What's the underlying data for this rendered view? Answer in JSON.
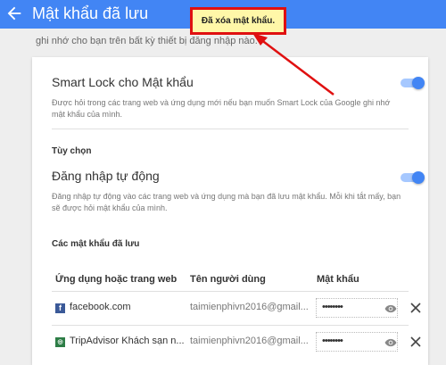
{
  "header": {
    "title": "Mật khẩu đã lưu",
    "bg_text_line1": "",
    "bg_text_line2": "ghi nhớ cho bạn trên bất kỳ thiết bị đăng nhập nào."
  },
  "smart_lock": {
    "title": "Smart Lock cho Mật khẩu",
    "description": "Được hỏi trong các trang web và ứng dụng mới nếu bạn muốn Smart Lock của Google ghi nhớ mật khẩu của mình.",
    "enabled": true
  },
  "options": {
    "heading": "Tùy chọn",
    "auto_signin_title": "Đăng nhập tự động",
    "auto_signin_description": "Đăng nhập tự động vào các trang web và ứng dụng mà bạn đã lưu mật khẩu. Mỗi khi tắt mấy, bạn sẽ được hỏi mật khẩu của mình.",
    "enabled": true
  },
  "saved_passwords": {
    "heading": "Các mật khẩu đã lưu",
    "columns": [
      "Ứng dụng hoặc trang web",
      "Tên người dùng",
      "Mật khẩu"
    ],
    "rows": [
      {
        "icon": "facebook-icon",
        "site": "facebook.com",
        "user": "taimienphivn2016@gmail...",
        "password": "••••••••"
      },
      {
        "icon": "tripadvisor-icon",
        "site": "TripAdvisor Khách sạn n...",
        "user": "taimienphivn2016@gmail...",
        "password": "••••••••"
      }
    ]
  },
  "toast": {
    "text": "Đã xóa mật khẩu."
  },
  "colors": {
    "accent": "#4285f4",
    "toast_bg": "#fff7a8",
    "highlight": "#e01010"
  }
}
